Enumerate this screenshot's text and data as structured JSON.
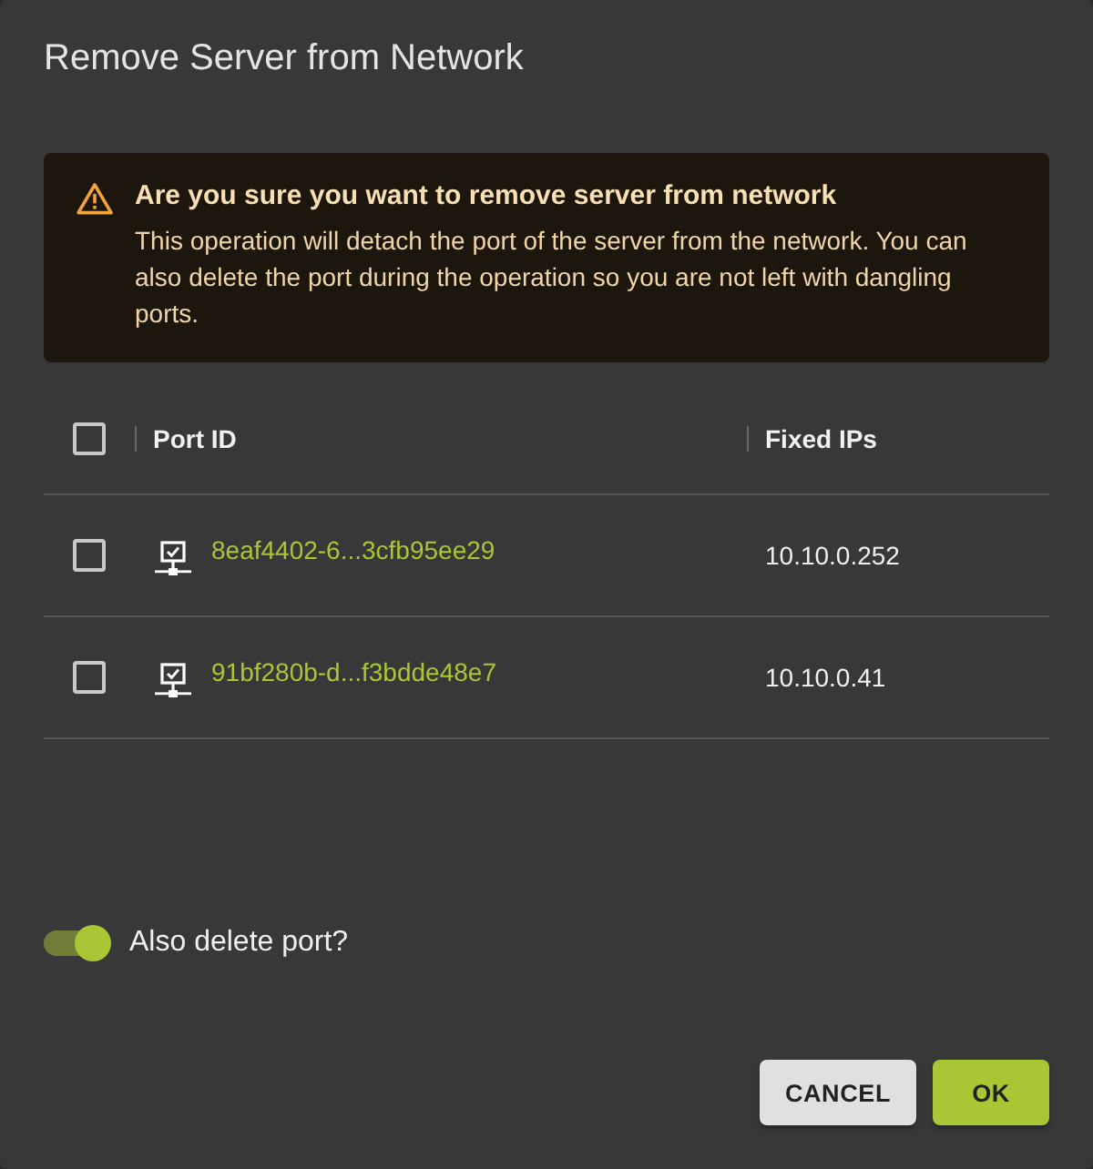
{
  "dialog": {
    "title": "Remove Server from Network"
  },
  "alert": {
    "kind": "warning",
    "title": "Are you sure you want to remove server from network",
    "message": "This operation will detach the port of the server from the network. You can also delete the port during the operation so you are not left with dangling ports."
  },
  "table": {
    "select_all": {
      "checked": false
    },
    "columns": [
      "Port ID",
      "Fixed IPs"
    ],
    "rows": [
      {
        "checked": false,
        "port_id": "8eaf4402-6...3cfb95ee29",
        "fixed_ips": "10.10.0.252"
      },
      {
        "checked": false,
        "port_id": "91bf280b-d...f3bdde48e7",
        "fixed_ips": "10.10.0.41"
      }
    ]
  },
  "toggle": {
    "label": "Also delete port?",
    "on": true
  },
  "buttons": [
    {
      "label": "CANCEL",
      "kind": "secondary"
    },
    {
      "label": "OK",
      "kind": "primary"
    }
  ]
}
